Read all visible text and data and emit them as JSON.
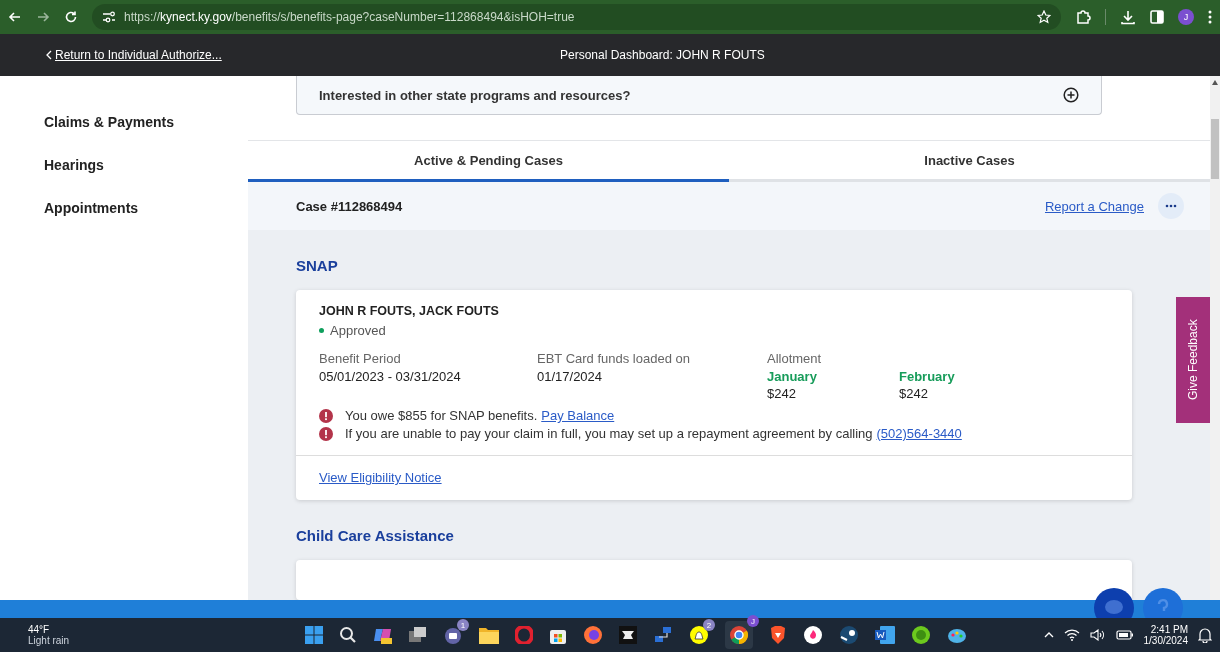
{
  "browser": {
    "url": "https://**kynect.ky.gov**/benefits/s/benefits-page?caseNumber=112868494&isHOH=true",
    "profile": "J"
  },
  "header": {
    "back_link": "Return to Individual Authorize...",
    "title": "Personal Dashboard: JOHN R FOUTS"
  },
  "sidebar": {
    "items": [
      {
        "label": "Claims & Payments",
        "selected": false
      },
      {
        "label": "Hearings",
        "selected": false
      },
      {
        "label": "Appointments",
        "selected": false
      }
    ]
  },
  "resources": {
    "question": "Interested in other state programs and resources?"
  },
  "tabs": [
    {
      "label": "Active & Pending Cases",
      "selected": true
    },
    {
      "label": "Inactive Cases",
      "selected": false
    }
  ],
  "case": {
    "number": "Case #112868494",
    "report_link": "Report a Change"
  },
  "programs": [
    {
      "title": "SNAP",
      "card": {
        "members": "JOHN R FOUTS, JACK FOUTS",
        "status": {
          "text": "Approved",
          "color": "#0e9f5c"
        },
        "fields": [
          {
            "label": "Benefit Period",
            "value": "05/01/2023 - 03/31/2024"
          },
          {
            "label": "EBT Card funds loaded on",
            "value": "01/17/2024"
          }
        ],
        "allotment": {
          "label": "Allotment",
          "months": [
            {
              "month": "January",
              "amount": "$242"
            },
            {
              "month": "February",
              "amount": "$242"
            }
          ]
        },
        "alerts": [
          {
            "text": "You owe $855 for SNAP benefits.",
            "link": "Pay Balance"
          },
          {
            "text": "If you are unable to pay your claim in full, you may set up a repayment agreement by calling",
            "link": "(502)564-3440"
          }
        ],
        "footer_link": "View Eligibility Notice"
      }
    },
    {
      "title": "Child Care Assistance"
    }
  ],
  "feedback": "Give Feedback",
  "taskbar": {
    "temperature": "44°F",
    "weather": "Light rain",
    "time": "2:41 PM",
    "date": "1/30/2024",
    "teams_badge": "1",
    "snap_badge": "2",
    "chrome_badge": "J"
  }
}
